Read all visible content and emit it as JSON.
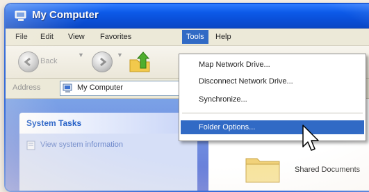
{
  "window": {
    "title": "My Computer"
  },
  "menubar": {
    "items": [
      {
        "label": "File"
      },
      {
        "label": "Edit"
      },
      {
        "label": "View"
      },
      {
        "label": "Favorites"
      },
      {
        "label": "Tools"
      },
      {
        "label": "Help"
      }
    ],
    "active_index": 4
  },
  "toolbar": {
    "back_label": "Back"
  },
  "address": {
    "label": "Address",
    "value": "My Computer"
  },
  "tools_menu": {
    "items": [
      {
        "label": "Map Network Drive..."
      },
      {
        "label": "Disconnect Network Drive..."
      },
      {
        "label": "Synchronize..."
      },
      {
        "label": "Folder Options..."
      }
    ],
    "highlighted_index": 3
  },
  "taskpane": {
    "header": "System Tasks",
    "items": [
      {
        "label": "View system information"
      }
    ]
  },
  "main": {
    "items": [
      {
        "label": "Shared Documents"
      }
    ]
  },
  "colors": {
    "titlebar": "#0a4ed6",
    "menu_highlight": "#316ac5",
    "taskpane": "#6f8fdf"
  }
}
